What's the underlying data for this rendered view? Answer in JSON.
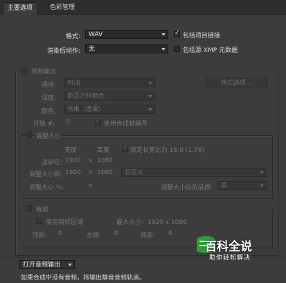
{
  "tabs": [
    {
      "label": "主要选项"
    },
    {
      "label": "色彩管理"
    }
  ],
  "main": {
    "format_label": "格式:",
    "format_value": "WAV",
    "include_project_link": "包括项目链接",
    "post_render_label": "渲染后动作:",
    "post_render_value": "无",
    "include_xmp": "包括源 XMP 元数据"
  },
  "video_output": {
    "title": "视频输出",
    "channel_label": "通道:",
    "channel_value": "RGB",
    "format_options_btn": "格式选项...",
    "depth_label": "深度:",
    "depth_value": "数百万种颜色",
    "color_label": "颜色:",
    "color_value": "预乘（遮罩）",
    "start_label": "开始 #:",
    "start_value": "0",
    "use_comp_frame": "使用合成帧编号"
  },
  "resize": {
    "title": "调整大小",
    "width_header": "宽度",
    "height_header": "高度",
    "lock_ratio": "锁定长宽比为 16:9 (1.78)",
    "render_at_label": "渲染在:",
    "render_w": "1920",
    "render_x": "x",
    "render_h": "1080",
    "resize_to_label": "调整大小到:",
    "resize_w": "1920",
    "resize_x": "x",
    "resize_h": "1080",
    "preset_value": "自定义",
    "pct_label": "调整大小 %:",
    "pct_x": "x",
    "quality_label": "调整大小后的品质:",
    "quality_value": "高"
  },
  "crop": {
    "title": "裁剪",
    "use_roi": "使用目标区域",
    "max_size": "最大大小：1920 x 1080",
    "top_label": "顶部:",
    "top_value": "0",
    "left_label": "左侧:",
    "left_value": "0",
    "bottom_label": "底部:",
    "bottom_value": "0"
  },
  "audio": {
    "dropdown_label": "打开音频输出",
    "note": "如果合成中没有音频，将输出静音音频轨道。"
  },
  "watermark": {
    "title": "百科全说",
    "subtitle": "助你轻松解决"
  },
  "colors": {
    "bg": "#3c3c3c",
    "watermark_green": "#2f9a3a"
  }
}
